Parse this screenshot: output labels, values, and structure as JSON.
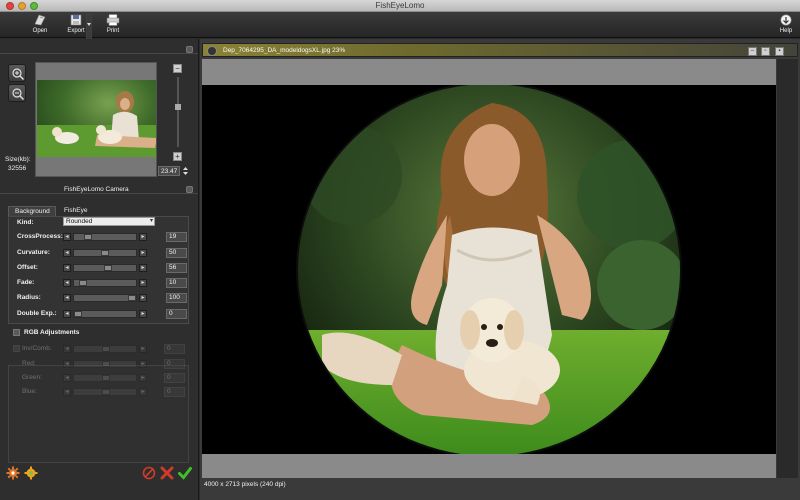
{
  "window": {
    "title": "FishEyeLomo"
  },
  "toolbar": {
    "open_label": "Open",
    "export_label": "Export",
    "print_label": "Print",
    "help_label": "Help"
  },
  "navigator": {
    "size_label": "Size(kb):",
    "size_value": "32556",
    "zoom_value": "23.47"
  },
  "camera_panel": {
    "title": "FishEyeLomo Camera"
  },
  "tabs": {
    "background": "Background",
    "fisheye": "FishEye"
  },
  "fisheye": {
    "kind_label": "Kind:",
    "kind_value": "Rounded",
    "params": [
      {
        "label": "CrossProcess:",
        "value": "19",
        "level": 0.19
      },
      {
        "label": "Curvature:",
        "value": "50",
        "level": 0.5
      },
      {
        "label": "Offset:",
        "value": "56",
        "level": 0.56
      },
      {
        "label": "Fade:",
        "value": "10",
        "level": 0.1
      },
      {
        "label": "Radius:",
        "value": "100",
        "level": 1.0
      },
      {
        "label": "Double Exp.:",
        "value": "0",
        "level": 0.0
      }
    ]
  },
  "rgb": {
    "title": "RGB Adjustments",
    "rows": [
      {
        "label": "Inv/Comb.",
        "value": "0"
      },
      {
        "label": "Red:",
        "value": "0"
      },
      {
        "label": "Green:",
        "value": "0"
      },
      {
        "label": "Blue:",
        "value": "0"
      }
    ]
  },
  "document": {
    "filename": "Dep_7064295_DA_modeldogsXL.jpg 23%",
    "status": "4000 x 2713 pixels (240 dpi)"
  },
  "colors": {
    "accent_green": "#3fbf2a",
    "cancel_red": "#d23a2a",
    "header_olive": "#8a8236"
  }
}
